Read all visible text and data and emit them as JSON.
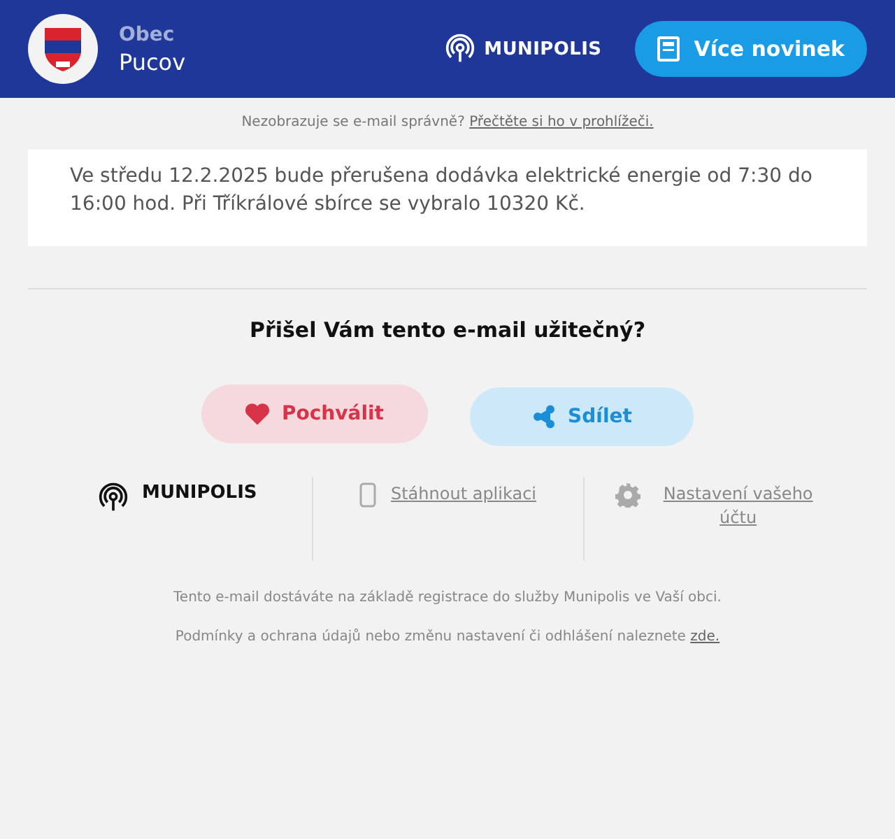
{
  "header": {
    "label": "Obec",
    "town": "Pucov",
    "brand": "MUNIPOLIS",
    "button": "Více novinek"
  },
  "notice": {
    "text": "Nezobrazuje se e-mail správně?",
    "link": "Přečtěte si ho v prohlížeči."
  },
  "message": "Ve středu 12.2.2025 bude přerušena dodávka elektrické energie od 7:30 do 16:00 hod. Při Tříkrálové sbírce se vybralo 10320 Kč.",
  "feedback": {
    "question": "Přišel Vám tento e-mail užitečný?",
    "buttons": [
      {
        "kind": "praise",
        "label": "Pochválit"
      },
      {
        "kind": "share",
        "label": "Sdílet"
      }
    ]
  },
  "footer_links": {
    "brand": "MUNIPOLIS",
    "items": [
      {
        "kind": "app",
        "label": "Stáhnout aplikaci"
      },
      {
        "kind": "settings",
        "label": "Nastavení vašeho účtu"
      }
    ]
  },
  "legal": {
    "line_1": "Tento e-mail dostáváte na základě registrace do služby Munipolis ve Vaší obci.",
    "line_2": "Podmínky a ochrana údajů nebo změnu nastavení či odhlášení naleznete",
    "link": "zde."
  }
}
